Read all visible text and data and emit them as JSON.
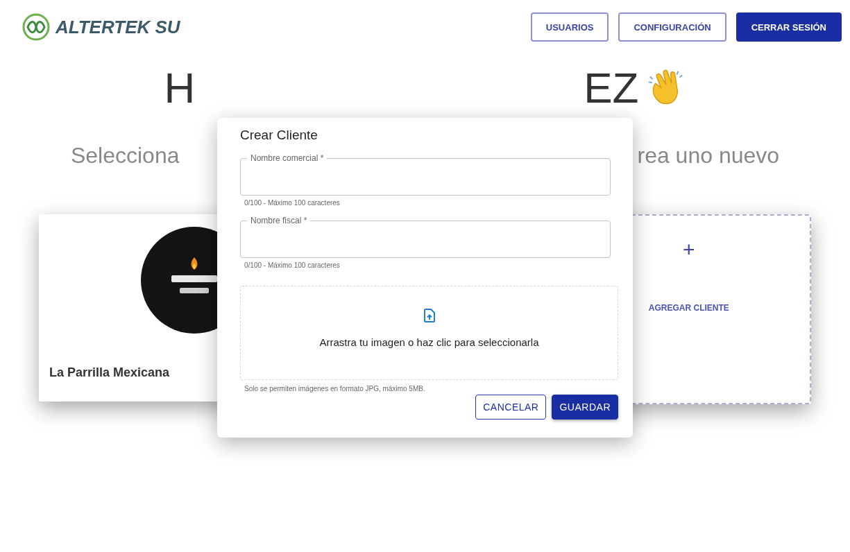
{
  "header": {
    "logo_text": "ALTERTEK SU",
    "buttons": [
      {
        "label": "USUARIOS",
        "kind": "outlined"
      },
      {
        "label": "CONFIGURACIÓN",
        "kind": "outlined"
      },
      {
        "label": "CERRAR SESIÓN",
        "kind": "filled"
      }
    ]
  },
  "greeting": {
    "heading_left": "H",
    "heading_right": "EZ",
    "subtitle_left": "Selecciona",
    "subtitle_right": "rea uno nuevo"
  },
  "clients": [
    {
      "kind": "client",
      "name": "La Parrilla Mexicana"
    },
    {
      "kind": "hidden"
    },
    {
      "kind": "add",
      "label": "AGREGAR CLIENTE",
      "icon": "+"
    }
  ],
  "dialog": {
    "title": "Crear Cliente",
    "fields": [
      {
        "label": "Nombre comercial *",
        "hint": "0/100 - Máximo 100 caracteres"
      },
      {
        "label": "Nombre fiscal *",
        "hint": "0/100 - Máximo 100 caracteres"
      }
    ],
    "upload": {
      "text": "Arrastra tu imagen o haz clic para seleccionarla",
      "hint": "Solo se permiten imágenes en formato JPG, máximo 5MB."
    },
    "actions": [
      {
        "label": "CANCELAR",
        "kind": "outlined"
      },
      {
        "label": "GUARDAR",
        "kind": "filled"
      }
    ]
  }
}
